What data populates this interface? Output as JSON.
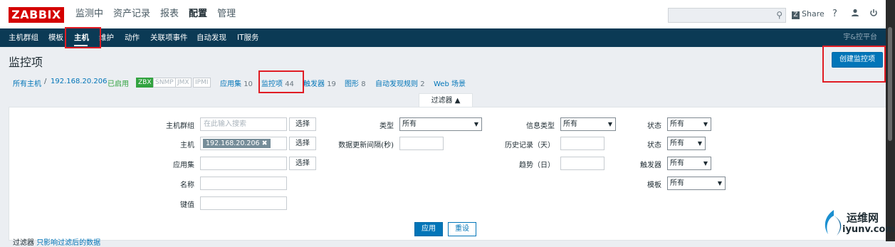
{
  "logo": "ZABBIX",
  "top_nav": [
    "监测中",
    "资产记录",
    "报表",
    "配置",
    "管理"
  ],
  "top_nav_active": "配置",
  "share_label": "Share",
  "help_icon": "?",
  "sub_nav": [
    "主机群组",
    "模板",
    "主机",
    "维护",
    "动作",
    "关联项事件",
    "自动发现",
    "IT服务"
  ],
  "sub_nav_active": "主机",
  "brand_right": "宇&控平台",
  "page_title": "监控项",
  "create_button": "创建监控项",
  "breadcrumb": {
    "all_hosts": "所有主机",
    "separator": "/",
    "host": "192.168.20.206",
    "status": "已启用",
    "badges": [
      "ZBX",
      "SNMP",
      "JMX",
      "IPMI"
    ],
    "tabs": [
      {
        "label": "应用集",
        "count": "10"
      },
      {
        "label": "监控项",
        "count": "44"
      },
      {
        "label": "触发器",
        "count": "19"
      },
      {
        "label": "图形",
        "count": "8"
      },
      {
        "label": "自动发现规则",
        "count": "2"
      },
      {
        "label": "Web 场景",
        "count": ""
      }
    ]
  },
  "filter_tab": "过滤器 ▲",
  "filter": {
    "hostgroup_label": "主机群组",
    "hostgroup_placeholder": "在此输入搜索",
    "select_label": "选择",
    "host_label": "主机",
    "host_value": "192.168.20.206",
    "remove_icon": "✖",
    "app_label": "应用集",
    "name_label": "名称",
    "key_label": "键值",
    "type_label": "类型",
    "type_value": "所有",
    "interval_label": "数据更新间隔(秒)",
    "info_type_label": "信息类型",
    "info_type_value": "所有",
    "history_label": "历史记录（天）",
    "trend_label": "趋势（日）",
    "state_label": "状态",
    "state_value": "所有",
    "status_label": "状态",
    "status_value": "所有",
    "trigger_label": "触发器",
    "trigger_value": "所有",
    "template_label": "模板",
    "template_value": "所有",
    "apply_button": "应用",
    "reset_button": "重设"
  },
  "filter_note": {
    "prefix": "过滤器",
    "text": "只影响过滤后的数据"
  },
  "watermark": {
    "line1": "运维网",
    "line2": "iyunv.com"
  },
  "colors": {
    "brand": "#d40000",
    "nav_bg": "#0b3a55",
    "primary": "#0275b8",
    "enabled": "#32a340",
    "highlight_box": "#e01c24"
  }
}
